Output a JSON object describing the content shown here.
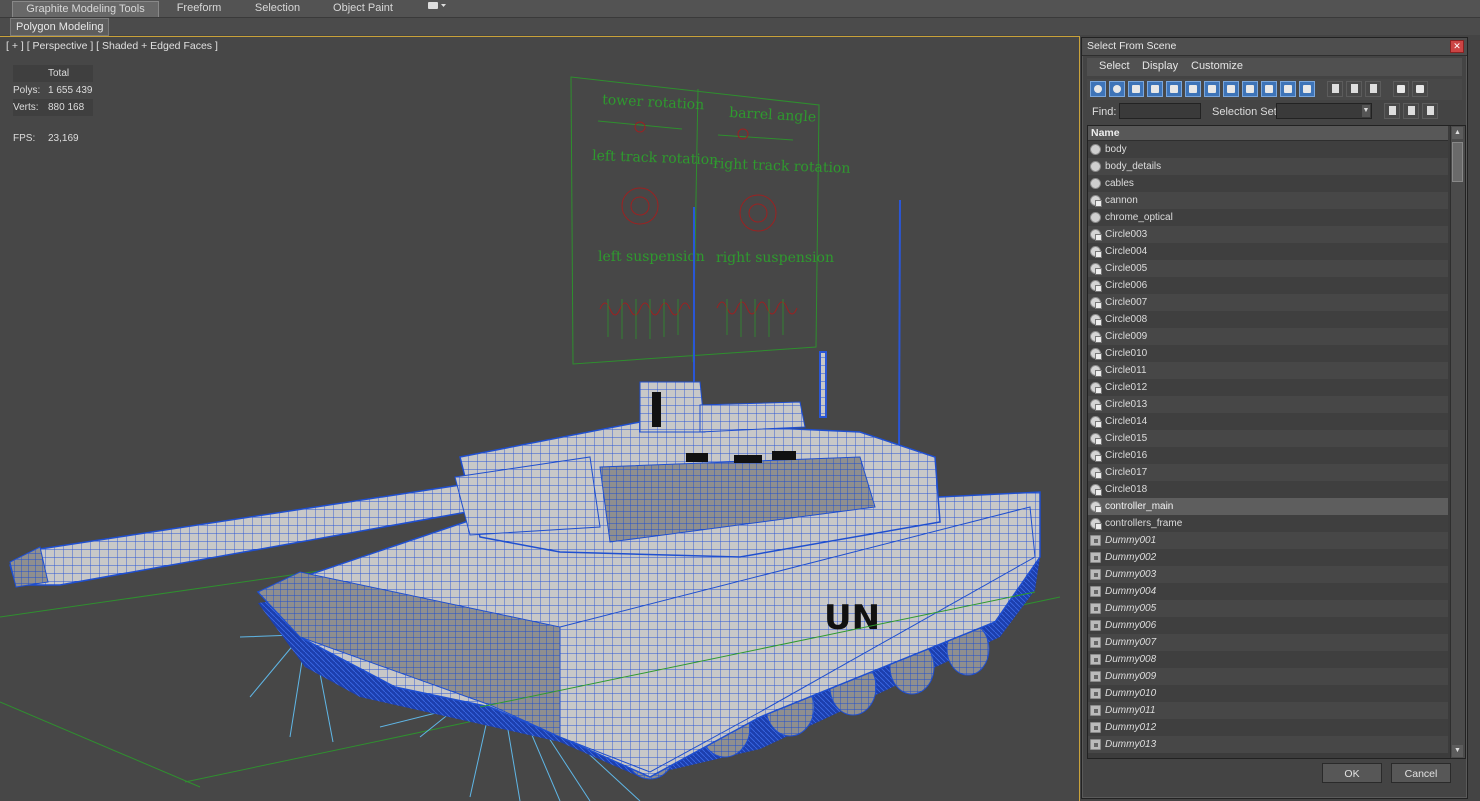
{
  "ribbon": {
    "tabs": [
      "Graphite Modeling Tools",
      "Freeform",
      "Selection",
      "Object Paint"
    ],
    "sub_tab": "Polygon Modeling"
  },
  "viewport": {
    "label": "[ + ] [ Perspective ] [ Shaded + Edged Faces ]",
    "stats": {
      "header": "Total",
      "polys_label": "Polys:",
      "polys_value": "1 655 439",
      "verts_label": "Verts:",
      "verts_value": "880 168",
      "fps_label": "FPS:",
      "fps_value": "23,169"
    },
    "panel_labels": {
      "tower_rotation": "tower rotation",
      "barrel_angle": "barrel angle",
      "left_track_rotation": "left track rotation",
      "right_track_rotation": "right track rotation",
      "left_suspension": "left suspension",
      "right_suspension": "right suspension"
    },
    "decal_text": "UN"
  },
  "dialog": {
    "title": "Select From Scene",
    "menu": [
      "Select",
      "Display",
      "Customize"
    ],
    "find_label": "Find:",
    "find_value": "",
    "selection_set_label": "Selection Set:",
    "selection_set_value": "",
    "column_header": "Name",
    "ok_label": "OK",
    "cancel_label": "Cancel",
    "objects": [
      {
        "name": "body",
        "type": "geo"
      },
      {
        "name": "body_details",
        "type": "geo"
      },
      {
        "name": "cables",
        "type": "geo"
      },
      {
        "name": "cannon",
        "type": "shape"
      },
      {
        "name": "chrome_optical",
        "type": "geo"
      },
      {
        "name": "Circle003",
        "type": "shape"
      },
      {
        "name": "Circle004",
        "type": "shape"
      },
      {
        "name": "Circle005",
        "type": "shape"
      },
      {
        "name": "Circle006",
        "type": "shape"
      },
      {
        "name": "Circle007",
        "type": "shape"
      },
      {
        "name": "Circle008",
        "type": "shape"
      },
      {
        "name": "Circle009",
        "type": "shape"
      },
      {
        "name": "Circle010",
        "type": "shape"
      },
      {
        "name": "Circle011",
        "type": "shape"
      },
      {
        "name": "Circle012",
        "type": "shape"
      },
      {
        "name": "Circle013",
        "type": "shape"
      },
      {
        "name": "Circle014",
        "type": "shape"
      },
      {
        "name": "Circle015",
        "type": "shape"
      },
      {
        "name": "Circle016",
        "type": "shape"
      },
      {
        "name": "Circle017",
        "type": "shape"
      },
      {
        "name": "Circle018",
        "type": "shape"
      },
      {
        "name": "controller_main",
        "type": "shape",
        "selected": true
      },
      {
        "name": "controllers_frame",
        "type": "shape"
      },
      {
        "name": "Dummy001",
        "type": "dummy"
      },
      {
        "name": "Dummy002",
        "type": "dummy"
      },
      {
        "name": "Dummy003",
        "type": "dummy"
      },
      {
        "name": "Dummy004",
        "type": "dummy"
      },
      {
        "name": "Dummy005",
        "type": "dummy"
      },
      {
        "name": "Dummy006",
        "type": "dummy"
      },
      {
        "name": "Dummy007",
        "type": "dummy"
      },
      {
        "name": "Dummy008",
        "type": "dummy"
      },
      {
        "name": "Dummy009",
        "type": "dummy"
      },
      {
        "name": "Dummy010",
        "type": "dummy"
      },
      {
        "name": "Dummy011",
        "type": "dummy"
      },
      {
        "name": "Dummy012",
        "type": "dummy"
      },
      {
        "name": "Dummy013",
        "type": "dummy"
      }
    ]
  },
  "colors": {
    "viewport_bg": "#474747",
    "wire_blue": "#1f4fd0",
    "controller_green": "#2e9a2e",
    "stats_yellow": "#e6dd6b",
    "active_border": "#c9a23a"
  }
}
